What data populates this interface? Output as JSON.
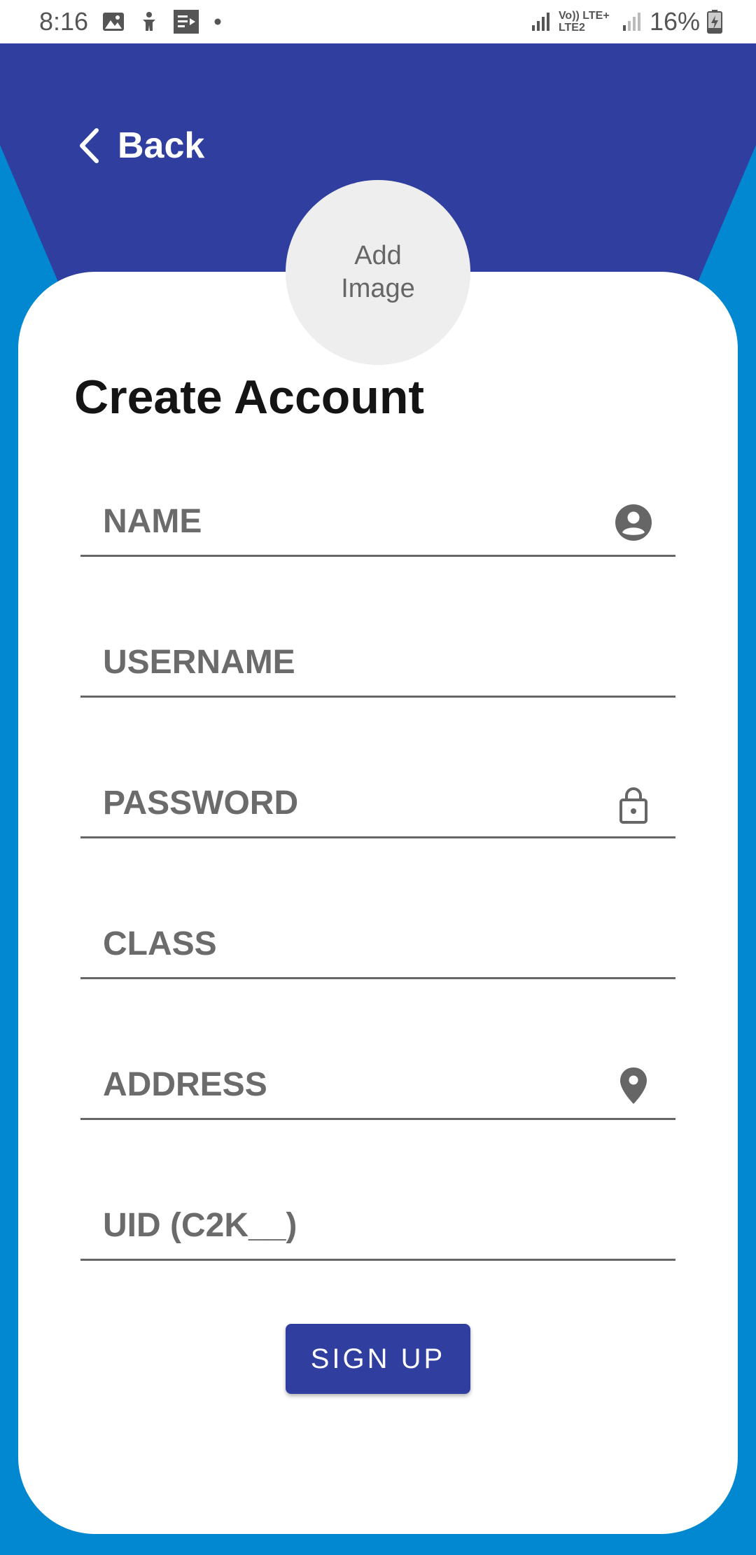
{
  "status_bar": {
    "time": "8:16",
    "network_text": "Vo)) LTE+ LTE2",
    "battery": "16%",
    "icons": [
      "image-icon",
      "accessibility-icon",
      "media-icon",
      "dot-icon",
      "signal-icon",
      "signal-icon-2",
      "battery-icon"
    ]
  },
  "colors": {
    "primary": "#303f9f",
    "secondary_bg": "#0288d1",
    "card": "#ffffff",
    "text_gray": "#666666"
  },
  "header": {
    "back_label": "Back"
  },
  "avatar": {
    "label": "Add Image"
  },
  "form": {
    "title": "Create Account",
    "fields": [
      {
        "placeholder": "NAME",
        "icon": "account-circle-icon"
      },
      {
        "placeholder": "USERNAME",
        "icon": ""
      },
      {
        "placeholder": "PASSWORD",
        "icon": "lock-icon"
      },
      {
        "placeholder": "CLASS",
        "icon": ""
      },
      {
        "placeholder": "ADDRESS",
        "icon": "location-pin-icon"
      },
      {
        "placeholder": "UID (C2K__)",
        "icon": ""
      }
    ],
    "submit_label": "SIGN UP"
  }
}
